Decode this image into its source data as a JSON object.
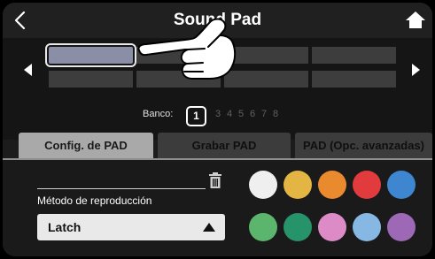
{
  "header": {
    "title": "Sound Pad",
    "back_icon": "chevron-left-icon",
    "home_icon": "home-icon"
  },
  "pads": {
    "count": 8,
    "selected_index": 0,
    "prev_icon": "triangle-left-icon",
    "next_icon": "triangle-right-icon"
  },
  "bank": {
    "label": "Banco:",
    "current": "1",
    "others": [
      "3",
      "4",
      "5",
      "6",
      "7",
      "8"
    ]
  },
  "tabs": [
    {
      "label": "Config. de PAD",
      "active": true
    },
    {
      "label": "Grabar PAD",
      "active": false
    },
    {
      "label": "PAD (Opc. avanzadas)",
      "active": false
    }
  ],
  "settings": {
    "trash_icon": "trash-icon",
    "method_label": "Método de reproducción",
    "method_value": "Latch",
    "method_arrow_icon": "triangle-up-icon"
  },
  "swatches": [
    "#efefef",
    "#e3b542",
    "#e98a2e",
    "#e23b3e",
    "#3f86d0",
    "#5bb56d",
    "#27936a",
    "#dc8bc6",
    "#86b8e3",
    "#9d69b6"
  ],
  "colors": {
    "background": "#1c1c1c",
    "selected_pad": "#8a8ea6",
    "pad": "#3d3d3d",
    "tab_active": "#a9a9a9",
    "tab_inactive": "#3c3c3c"
  }
}
